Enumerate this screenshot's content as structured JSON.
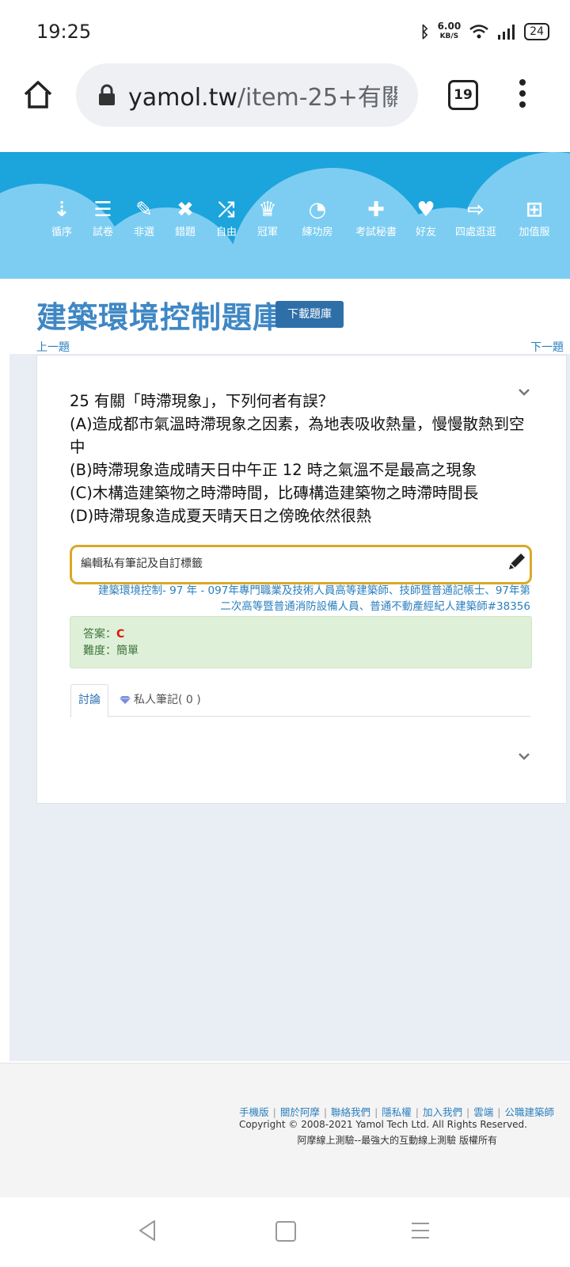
{
  "status_bar": {
    "time": "19:25",
    "net_speed": "6.00",
    "net_unit": "KB/S",
    "battery": "24"
  },
  "browser": {
    "url_host": "yamol.tw",
    "url_path": "/item-25+有關",
    "tab_count": "19"
  },
  "nav": {
    "items": [
      {
        "label": "循序",
        "icon": "sort-icon",
        "glyph": "⇣"
      },
      {
        "label": "試卷",
        "icon": "list-icon",
        "glyph": "☰"
      },
      {
        "label": "非選",
        "icon": "pencil-icon",
        "glyph": "✎"
      },
      {
        "label": "錯題",
        "icon": "x-icon",
        "glyph": "✖"
      },
      {
        "label": "自由",
        "icon": "shuffle-icon",
        "glyph": "⤮"
      },
      {
        "label": "冠軍",
        "icon": "trophy-icon",
        "glyph": "♛"
      },
      {
        "label": "練功房",
        "icon": "dashboard-icon",
        "glyph": "◔"
      },
      {
        "label": "考試秘書",
        "icon": "medkit-icon",
        "glyph": "✚"
      },
      {
        "label": "好友",
        "icon": "heart-icon",
        "glyph": "♥"
      },
      {
        "label": "四處逛逛",
        "icon": "share-icon",
        "glyph": "⇨"
      },
      {
        "label": "加值服",
        "icon": "cart-icon",
        "glyph": "⊞"
      }
    ]
  },
  "page": {
    "title": "建築環境控制題庫",
    "download_label": "下載題庫",
    "prev_label": "上一題",
    "next_label": "下一題"
  },
  "question": {
    "line1": "25 有關「時滯現象」，下列何者有誤？",
    "line2": "(A)造成都市氣溫時滯現象之因素，為地表吸收熱量，慢慢散熱到空中",
    "line3": "(B)時滯現象造成晴天日中午正 12 時之氣溫不是最高之現象",
    "line4": "(C)木構造建築物之時滯時間，比磚構造建築物之時滯時間長",
    "line5": "(D)時滯現象造成夏天晴天日之傍晚依然很熱"
  },
  "note": {
    "label": "編輯私有筆記及自訂標籤"
  },
  "source": {
    "line1": "建築環境控制- 97 年 - 097年專門職業及技術人員高等建築師、技師暨普通記帳士、97年第",
    "line2": "二次高等暨普通消防設備人員、普通不動產經紀人建築師#38356"
  },
  "answer": {
    "answer_label": "答案：",
    "answer_value": "C",
    "difficulty_label": "難度：",
    "difficulty_value": "簡單"
  },
  "tabs": {
    "discuss": "討論",
    "notes": "私人筆記( 0 )"
  },
  "footer": {
    "links": [
      "手機版",
      "關於阿摩",
      "聯絡我們",
      "隱私權",
      "加入我們",
      "雲端",
      "公職建築師"
    ],
    "copyright": "Copyright © 2008-2021 Yamol Tech Ltd. All Rights Reserved.",
    "slogan": "阿摩線上測驗--最強大的互動線上測驗 版權所有"
  },
  "colors": {
    "banner": "#1ca4dc",
    "cloud": "#7dcdf2",
    "title": "#3f87c4",
    "link": "#2a7fbf",
    "answer_bg": "#dff0d8",
    "note_border": "#d9a928"
  }
}
